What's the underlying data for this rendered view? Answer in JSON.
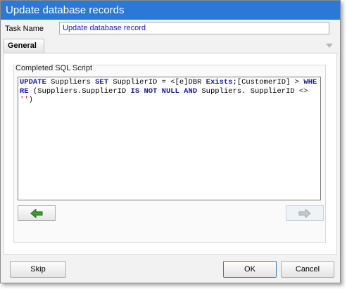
{
  "window": {
    "title": "Update database records"
  },
  "task": {
    "label": "Task Name",
    "value": "Update database record"
  },
  "tabs": [
    {
      "label": "General"
    }
  ],
  "group": {
    "label": "Completed SQL Script"
  },
  "sql": {
    "tokens": [
      {
        "t": "UPDATE",
        "k": "kw"
      },
      {
        "t": " Suppliers ",
        "k": ""
      },
      {
        "t": "SET",
        "k": "kw"
      },
      {
        "t": " SupplierID = <[e]DBR ",
        "k": ""
      },
      {
        "t": "Exists",
        "k": "kw"
      },
      {
        "t": ";[CustomerID] > ",
        "k": ""
      },
      {
        "t": "WHERE",
        "k": "kw"
      },
      {
        "t": " (Suppliers.SupplierID ",
        "k": ""
      },
      {
        "t": "IS NOT NULL AND",
        "k": "kw"
      },
      {
        "t": " Suppliers. SupplierID <> ",
        "k": ""
      },
      {
        "t": "''",
        "k": "str"
      },
      {
        "t": ")",
        "k": ""
      }
    ]
  },
  "buttons": {
    "skip": "Skip",
    "ok": "OK",
    "cancel": "Cancel"
  },
  "icons": {
    "back": "green-left-arrow-icon",
    "next": "gray-right-arrow-icon"
  }
}
